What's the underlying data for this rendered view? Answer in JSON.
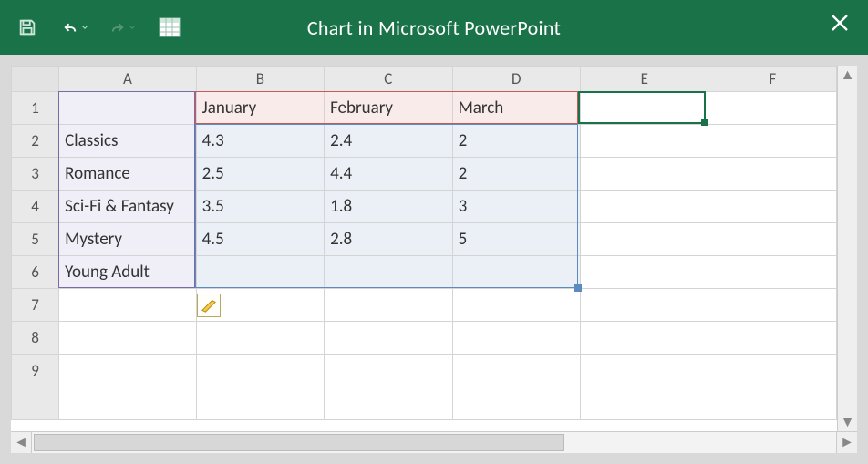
{
  "titlebar": {
    "title": "Chart in Microsoft PowerPoint"
  },
  "columns": [
    "A",
    "B",
    "C",
    "D",
    "E",
    "F"
  ],
  "rows": [
    "1",
    "2",
    "3",
    "4",
    "5",
    "6",
    "7",
    "8",
    "9"
  ],
  "headers": {
    "B1": "January",
    "C1": "February",
    "D1": "March"
  },
  "categories": {
    "A2": "Classics",
    "A3": "Romance",
    "A4": "Sci-Fi & Fantasy",
    "A5": "Mystery",
    "A6": "Young Adult"
  },
  "values": {
    "B2": "4.3",
    "C2": "2.4",
    "D2": "2",
    "B3": "2.5",
    "C3": "4.4",
    "D3": "2",
    "B4": "3.5",
    "C4": "1.8",
    "D4": "3",
    "B5": "4.5",
    "C5": "2.8",
    "D5": "5"
  },
  "chart_data": {
    "type": "bar",
    "categories": [
      "Classics",
      "Romance",
      "Sci-Fi & Fantasy",
      "Mystery",
      "Young Adult"
    ],
    "series": [
      {
        "name": "January",
        "values": [
          4.3,
          2.5,
          3.5,
          4.5,
          null
        ]
      },
      {
        "name": "February",
        "values": [
          2.4,
          4.4,
          1.8,
          2.8,
          null
        ]
      },
      {
        "name": "March",
        "values": [
          2,
          2,
          3,
          5,
          null
        ]
      }
    ]
  }
}
